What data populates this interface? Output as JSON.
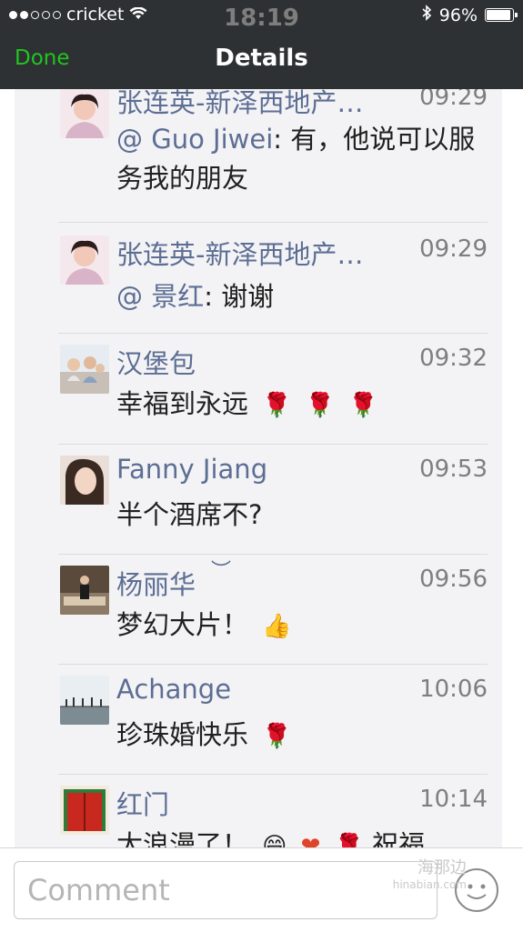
{
  "status_bar": {
    "carrier": "cricket",
    "time": "18:19",
    "battery": "96%",
    "signal_dots_filled": 2,
    "signal_dots_total": 5
  },
  "nav": {
    "done_label": "Done",
    "title": "Details",
    "done_color": "#20c520"
  },
  "comments": [
    {
      "name": "张连英-新泽西地产…",
      "time": "09:29",
      "mention": "@ Guo Jiwei",
      "text": ": 有，他说可以服务我的朋友",
      "avatar_icon": "woman-portrait-icon"
    },
    {
      "name": "张连英-新泽西地产…",
      "time": "09:29",
      "mention": "@ 景红",
      "text": ": 谢谢",
      "avatar_icon": "woman-portrait-icon"
    },
    {
      "name": "汉堡包",
      "time": "09:32",
      "text": "幸福到永远",
      "emojis": [
        "rose-icon",
        "rose-icon",
        "rose-icon"
      ],
      "avatar_icon": "group-photo-icon"
    },
    {
      "name": "Fanny Jiang",
      "time": "09:53",
      "text": "半个酒席不?",
      "avatar_icon": "woman-selfie-icon"
    },
    {
      "name": "杨丽华",
      "time": "09:56",
      "text": "梦幻大片！",
      "emojis": [
        "thumbs-up-icon"
      ],
      "avatar_icon": "man-sitting-icon"
    },
    {
      "name": "Achange",
      "time": "10:06",
      "text": "珍珠婚快乐",
      "emojis": [
        "rose-icon"
      ],
      "avatar_icon": "landscape-icon"
    },
    {
      "name": "红门",
      "time": "10:14",
      "text": "太浪漫了！",
      "emojis": [
        "grinning-face-icon",
        "heart-icon",
        "rose-icon"
      ],
      "text_tail": "祝福",
      "avatar_icon": "red-door-icon"
    }
  ],
  "composer": {
    "placeholder": "Comment",
    "watermark": "海那边",
    "watermark_sub": "hinabian.com"
  },
  "colors": {
    "name": "#5d6e94",
    "time": "#7e7e7e",
    "bar": "#2e3133",
    "panel": "#f3f3f5"
  }
}
